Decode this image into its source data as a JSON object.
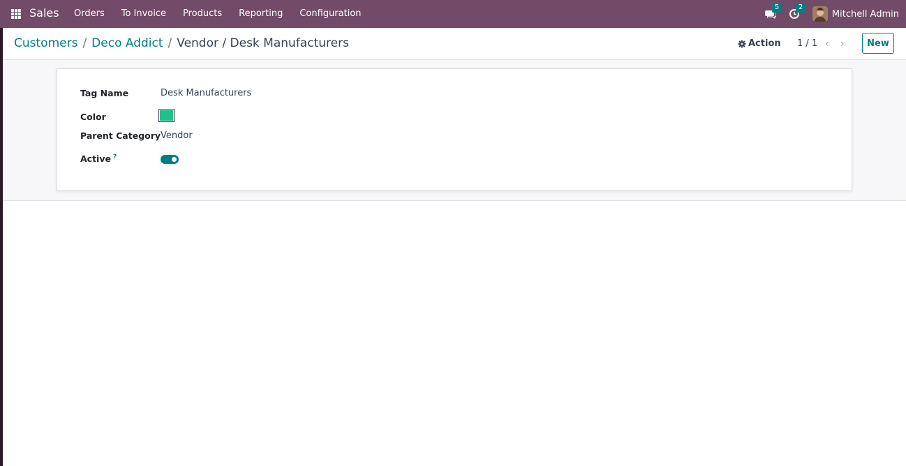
{
  "navbar": {
    "app_name": "Sales",
    "menu": [
      "Orders",
      "To Invoice",
      "Products",
      "Reporting",
      "Configuration"
    ],
    "messages_count": "5",
    "activities_count": "2",
    "user_name": "Mitchell Admin",
    "bg_color": "#714b67"
  },
  "breadcrumb": {
    "items": [
      "Customers",
      "Deco Addict"
    ],
    "current": "Vendor / Desk Manufacturers",
    "separator": "/"
  },
  "control_panel": {
    "action_label": "Action",
    "pager": "1 / 1",
    "new_label": "New"
  },
  "form": {
    "tag_name_label": "Tag Name",
    "tag_name_value": "Desk Manufacturers",
    "color_label": "Color",
    "color_value": "#21c08b",
    "parent_category_label": "Parent Category",
    "parent_category_value": "Vendor",
    "active_label": "Active",
    "active_help": "?",
    "active_value": true
  },
  "icons": {
    "apps": "apps-grid-icon",
    "messages": "chat-icon",
    "activities": "clock-icon",
    "action": "gear-icon",
    "prev": "chevron-left-icon",
    "next": "chevron-right-icon"
  },
  "accent_color": "#017e84"
}
